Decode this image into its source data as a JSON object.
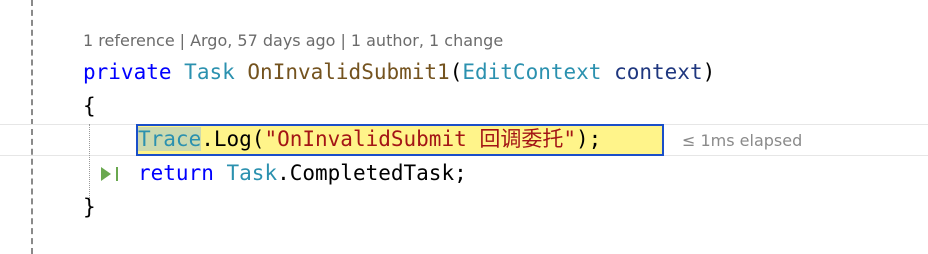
{
  "codelens": {
    "references": "1 reference",
    "separator": "|",
    "blame": "Argo, 57 days ago",
    "authors": "1 author, 1 change"
  },
  "code": {
    "line1": {
      "kw_private": "private",
      "type_task": "Task",
      "method_name": "OnInvalidSubmit1",
      "open_paren": "(",
      "param_type": "EditContext",
      "param_name": "context",
      "close_paren": ")"
    },
    "line2": {
      "brace": "{"
    },
    "line3": {
      "trace": "Trace",
      "rest": ".Log(",
      "string": "\"OnInvalidSubmit 回调委托\"",
      "end": ");"
    },
    "line4": {
      "kw_return": "return",
      "task": "Task",
      "rest": ".CompletedTask;"
    },
    "line5": {
      "brace": "}"
    }
  },
  "perf_tip": "≤ 1ms elapsed",
  "icons": {
    "run_to_click": "run-to-click-icon"
  },
  "colors": {
    "keyword": "#0000ff",
    "type": "#2b91af",
    "string": "#a31515",
    "current_statement_bg": "#fff48a",
    "current_statement_border": "#1a4fc9"
  }
}
